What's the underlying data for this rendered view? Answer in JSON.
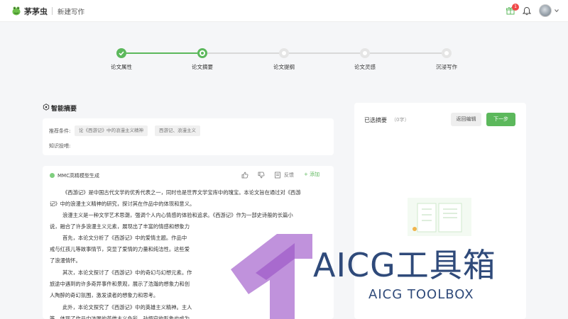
{
  "header": {
    "brand": "茅茅虫",
    "page_name": "新建写作",
    "notification_count": "1",
    "accent_color": "#5cb85c"
  },
  "stepper": {
    "steps": [
      {
        "label": "论文属性",
        "state": "done"
      },
      {
        "label": "论文摘要",
        "state": "current"
      },
      {
        "label": "论文提纲",
        "state": "todo"
      },
      {
        "label": "论文灵感",
        "state": "todo"
      },
      {
        "label": "沉浸写作",
        "state": "todo"
      }
    ]
  },
  "section": {
    "title": "智能摘要"
  },
  "filters": {
    "recommend_label": "推荐条件:",
    "chips": [
      "论《西游记》中的浪漫主义精神",
      "西游记、浪漫主义"
    ],
    "knowledge_label": "知识投喂:"
  },
  "result": {
    "model_name": "MMC高精模型生成",
    "feedback_label": "反馈",
    "add_label": "+ 添加",
    "lines": [
      "《西游记》是中国古代文学的优秀代表之一，同时也是世界文学宝库中的瑰宝。本论文旨在通过对《西游",
      "记》中的浪漫主义精神的研究，探讨其在作品中的体现和意义。",
      "浪漫主义是一种文学艺术思潮，强调个人内心情感的体验和追求。《西游记》作为一部史诗般的长篇小",
      "说，融合了许多浪漫主义元素，展现出了丰富的情感和想象力",
      "首先，本论文分析了《西游记》中的爱情主题。作品中",
      "戒与红孩儿等故事情节，突显了爱情的力量和纯洁性。这些爱",
      "了浪漫情怀。",
      "其次，本论文探讨了《西游记》中的奇幻与幻想元素。作",
      "旅途中遇到的许多奇异事件和景观，展示了浩瀚的想象力和创",
      "人陶醉的奇幻氛围，激发读者的想象力和思考。",
      "此外，本论文探究了《西游记》中的英雄主义精神。主人",
      "等，体现了作品中浓厚的英雄主义色彩。孙悟空的形象也成为"
    ]
  },
  "selected": {
    "title": "已选摘要",
    "count": "（0字）",
    "back_label": "返回编辑",
    "next_label": "下一步"
  },
  "watermark": {
    "title": "AICG工具箱",
    "subtitle": "AICG TOOLBOX"
  }
}
